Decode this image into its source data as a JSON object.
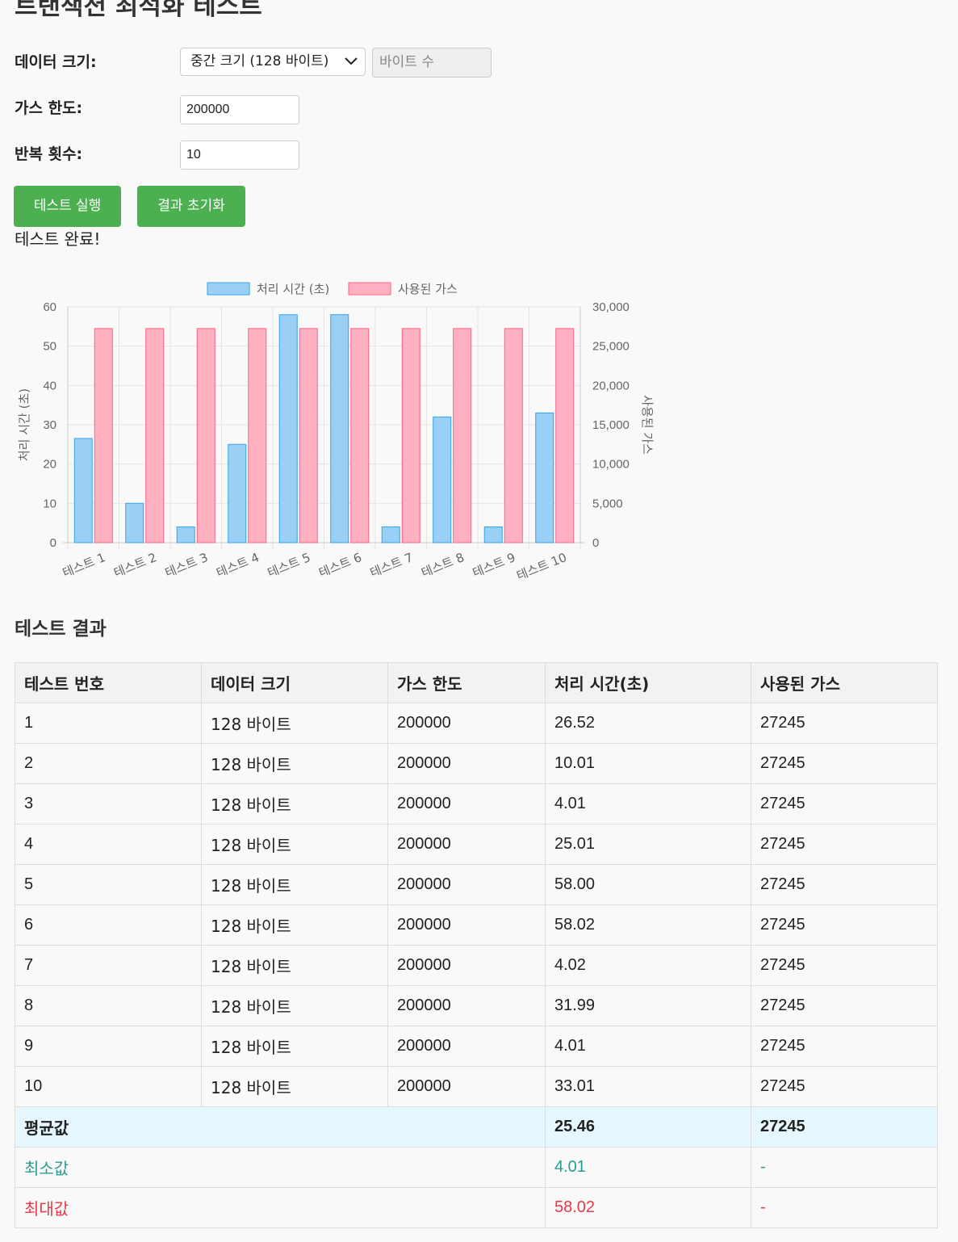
{
  "page": {
    "title": "트랜잭션 최적화 테스트"
  },
  "form": {
    "data_size": {
      "label": "데이터 크기:",
      "selected": "중간 크기 (128 바이트)",
      "bytes_placeholder": "바이트 수"
    },
    "gas_limit": {
      "label": "가스 한도:",
      "value": "200000"
    },
    "iterations": {
      "label": "반복 횟수:",
      "value": "10"
    }
  },
  "buttons": {
    "run": "테스트 실행",
    "reset": "결과 초기화"
  },
  "status": "테스트 완료!",
  "chart_data": {
    "type": "bar",
    "categories": [
      "테스트 1",
      "테스트 2",
      "테스트 3",
      "테스트 4",
      "테스트 5",
      "테스트 6",
      "테스트 7",
      "테스트 8",
      "테스트 9",
      "테스트 10"
    ],
    "series": [
      {
        "name": "처리 시간 (초)",
        "axis": "left",
        "values": [
          26.52,
          10.01,
          4.01,
          25.01,
          58.0,
          58.02,
          4.02,
          31.99,
          4.01,
          33.01
        ],
        "fill": "#9ad0f5",
        "stroke": "#36a2eb"
      },
      {
        "name": "사용된 가스",
        "axis": "right",
        "values": [
          27245,
          27245,
          27245,
          27245,
          27245,
          27245,
          27245,
          27245,
          27245,
          27245
        ],
        "fill": "#ffb1c1",
        "stroke": "#ff6384"
      }
    ],
    "ylabel": "처리 시간 (초)",
    "ylabel_right": "사용된 가스",
    "ylim": [
      0,
      60
    ],
    "ylim_right": [
      0,
      30000
    ],
    "yticks": [
      "0",
      "10",
      "20",
      "30",
      "40",
      "50",
      "60"
    ],
    "yticks_right": [
      "0",
      "5,000",
      "10,000",
      "15,000",
      "20,000",
      "25,000",
      "30,000"
    ],
    "grid": true,
    "legend": "top"
  },
  "results": {
    "title": "테스트 결과",
    "headers": [
      "테스트 번호",
      "데이터 크기",
      "가스 한도",
      "처리 시간(초)",
      "사용된 가스"
    ],
    "rows": [
      [
        "1",
        "128 바이트",
        "200000",
        "26.52",
        "27245"
      ],
      [
        "2",
        "128 바이트",
        "200000",
        "10.01",
        "27245"
      ],
      [
        "3",
        "128 바이트",
        "200000",
        "4.01",
        "27245"
      ],
      [
        "4",
        "128 바이트",
        "200000",
        "25.01",
        "27245"
      ],
      [
        "5",
        "128 바이트",
        "200000",
        "58.00",
        "27245"
      ],
      [
        "6",
        "128 바이트",
        "200000",
        "58.02",
        "27245"
      ],
      [
        "7",
        "128 바이트",
        "200000",
        "4.02",
        "27245"
      ],
      [
        "8",
        "128 바이트",
        "200000",
        "31.99",
        "27245"
      ],
      [
        "9",
        "128 바이트",
        "200000",
        "4.01",
        "27245"
      ],
      [
        "10",
        "128 바이트",
        "200000",
        "33.01",
        "27245"
      ]
    ],
    "average": {
      "label": "평균값",
      "time": "25.46",
      "gas": "27245"
    },
    "minimum": {
      "label": "최소값",
      "time": "4.01",
      "gas": "-"
    },
    "maximum": {
      "label": "최대값",
      "time": "58.02",
      "gas": "-"
    }
  }
}
